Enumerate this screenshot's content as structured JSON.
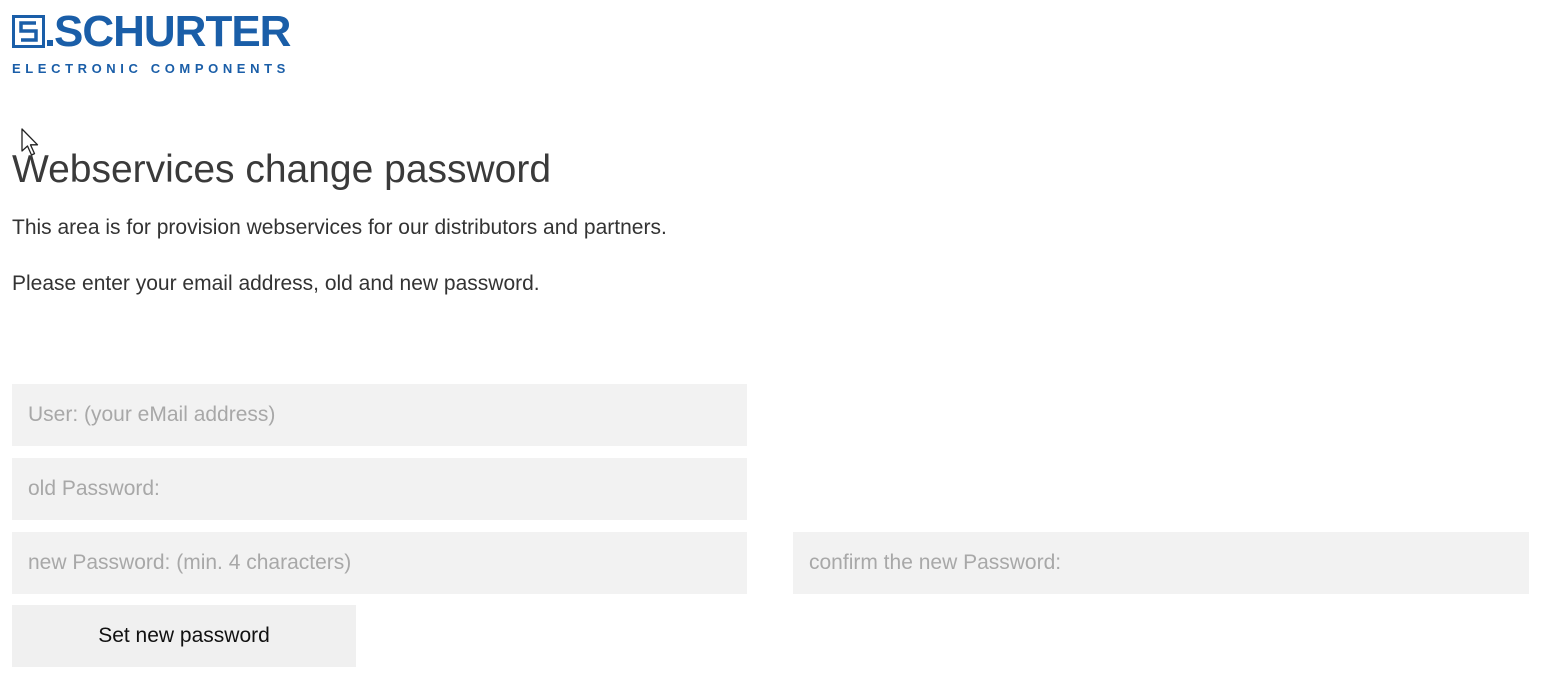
{
  "brand": {
    "name": "SCHURTER",
    "tagline": "ELECTRONIC COMPONENTS",
    "color": "#1a5ea8",
    "logo_icon": "schurter-s-mark-icon"
  },
  "page": {
    "title": "Webservices change password",
    "intro_line_1": "This area is for provision webservices for our distributors and partners.",
    "intro_line_2": "Please enter your email address, old and new password."
  },
  "form": {
    "user": {
      "value": "",
      "placeholder": "User: (your eMail address)"
    },
    "old_password": {
      "value": "",
      "placeholder": "old Password:"
    },
    "new_password": {
      "value": "",
      "placeholder": "new Password: (min. 4 characters)"
    },
    "confirm_password": {
      "value": "",
      "placeholder": "confirm the new Password:"
    },
    "submit_label": "Set new password"
  },
  "colors": {
    "field_background": "#f2f2f2",
    "placeholder_text": "#a8a8a8",
    "body_text": "#333333"
  }
}
